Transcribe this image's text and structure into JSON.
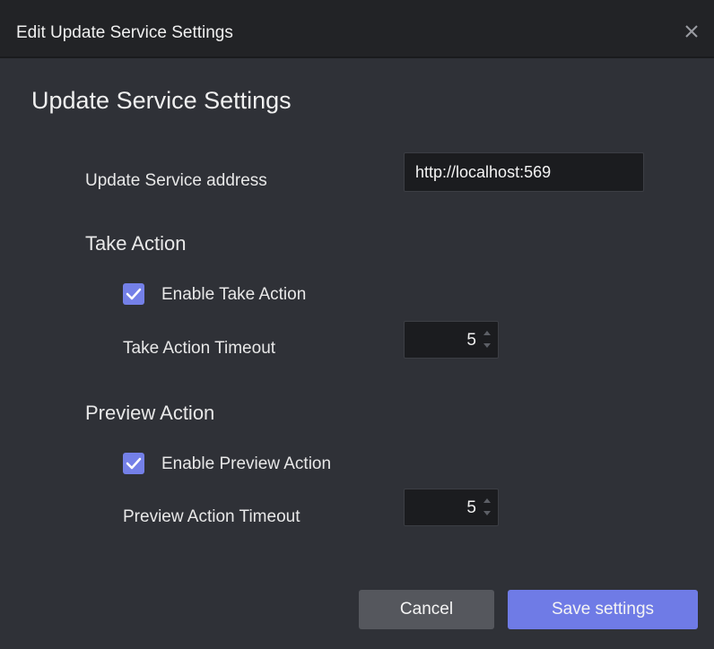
{
  "window": {
    "title": "Edit Update Service Settings"
  },
  "main": {
    "heading": "Update Service Settings",
    "address": {
      "label": "Update Service address",
      "value": "http://localhost:569"
    },
    "take_action": {
      "section_title": "Take Action",
      "enable_label": "Enable Take Action",
      "enabled": true,
      "timeout_label": "Take Action Timeout",
      "timeout_value": "5"
    },
    "preview_action": {
      "section_title": "Preview Action",
      "enable_label": "Enable Preview Action",
      "enabled": true,
      "timeout_label": "Preview Action Timeout",
      "timeout_value": "5"
    }
  },
  "footer": {
    "cancel_label": "Cancel",
    "save_label": "Save settings"
  },
  "colors": {
    "background": "#2f3137",
    "titlebar": "#222326",
    "accent": "#6f7be6",
    "input_bg": "#1b1c1f",
    "cancel_bg": "#55575d"
  },
  "icons": {
    "close": "close-icon",
    "check": "checkmark-icon",
    "stepper_up": "chevron-up-icon",
    "stepper_down": "chevron-down-icon"
  }
}
